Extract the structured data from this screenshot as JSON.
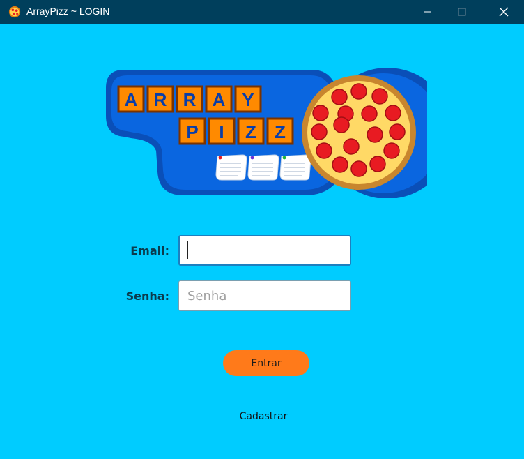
{
  "window": {
    "title": "ArrayPizz ~ LOGIN",
    "app_icon": "pizza-icon",
    "controls": {
      "minimize": "minimize-icon",
      "maximize": "maximize-icon",
      "close": "close-icon"
    }
  },
  "logo": {
    "row1": [
      "A",
      "R",
      "R",
      "A",
      "Y"
    ],
    "row2": [
      "P",
      "I",
      "Z",
      "Z"
    ]
  },
  "form": {
    "email_label": "Email:",
    "email_value": "",
    "email_placeholder": "",
    "senha_label": "Senha:",
    "senha_value": "",
    "senha_placeholder": "Senha",
    "submit_label": "Entrar",
    "register_link": "Cadastrar"
  },
  "colors": {
    "background": "#00ccff",
    "titlebar": "#003f5c",
    "accent": "#ff7a1a",
    "logo_blue": "#0a5fd6",
    "pizza_red": "#e81b22"
  }
}
